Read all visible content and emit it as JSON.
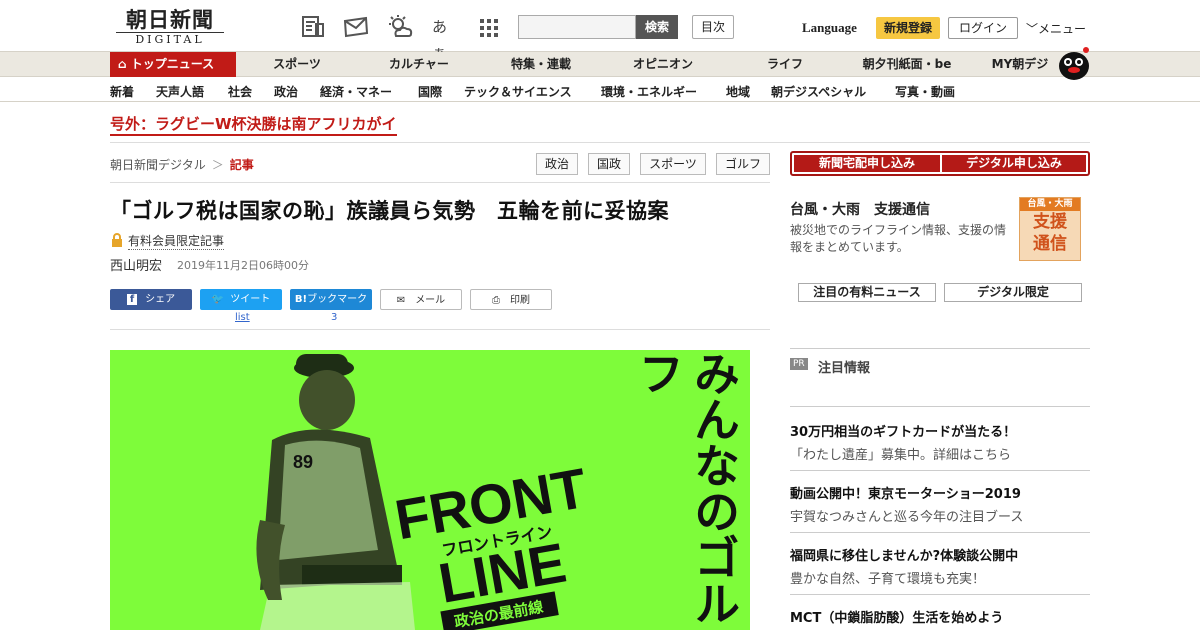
{
  "header": {
    "logo_jp": "朝日新聞",
    "logo_en": "DIGITAL",
    "search_button": "検索",
    "toc_button": "目次",
    "language": "Language",
    "signup": "新規登録",
    "login": "ログイン",
    "menu": "メニュー",
    "icons": [
      "newspaper-icon",
      "mail-icon",
      "weather-icon",
      "font-size-icon",
      "grid-icon"
    ],
    "font_size_label": "あぁ"
  },
  "global_nav": [
    {
      "label": "トップニュース",
      "active": true
    },
    {
      "label": "スポーツ"
    },
    {
      "label": "カルチャー"
    },
    {
      "label": "特集・連載"
    },
    {
      "label": "オピニオン"
    },
    {
      "label": "ライフ"
    },
    {
      "label": "朝夕刊紙面・be"
    },
    {
      "label": "MY朝デジ"
    }
  ],
  "sub_nav": [
    "新着",
    "天声人語",
    "社会",
    "政治",
    "経済・マネー",
    "国際",
    "テック＆サイエンス",
    "環境・エネルギー",
    "地域",
    "朝デジスペシャル",
    "写真・動画"
  ],
  "breaking": "号外：ラグビーW杯決勝は南アフリカがイ",
  "breadcrumb": {
    "site": "朝日新聞デジタル",
    "sep": "＞",
    "current": "記事"
  },
  "tags": [
    "政治",
    "国政",
    "スポーツ",
    "ゴルフ"
  ],
  "article": {
    "headline": "「ゴルフ税は国家の恥」族議員ら気勢　五輪を前に妥協案",
    "paid_label": "有料会員限定記事",
    "author": "西山明宏",
    "date": "2019年11月2日06時00分"
  },
  "share": {
    "facebook": "シェア",
    "twitter": "ツイート",
    "hatena": "ブックマーク",
    "mail": "メール",
    "print": "印刷",
    "twitter_count": "list",
    "hatena_count": "3"
  },
  "hero": {
    "vertical_text": "みんなのゴルフ",
    "front": "FRONT",
    "line": "LINE",
    "kana": "フロントライン",
    "subtitle": "政治の最前線",
    "cap_text": "89",
    "colors": {
      "bg": "#7efc3a",
      "ink": "#111111"
    }
  },
  "sidebar": {
    "tabs": [
      "新聞宅配申し込み",
      "デジタル申し込み"
    ],
    "typhoon_title": "台風・大雨　支援通信",
    "typhoon_desc": "被災地でのライフライン情報、支援の情報をまとめています。",
    "typhoon_badge": [
      "台風・大雨",
      "支援",
      "通信"
    ],
    "boxes": [
      "注目の有料ニュース",
      "デジタル限定"
    ],
    "pr_badge": "PR",
    "pr_title": "注目情報",
    "ads": [
      {
        "title": "30万円相当のギフトカードが当たる！",
        "sub": "「わたし遺産」募集中。詳細はこちら"
      },
      {
        "title": "動画公開中！東京モーターショー2019",
        "sub": "宇賀なつみさんと巡る今年の注目ブース"
      },
      {
        "title": "福岡県に移住しませんか?体験談公開中",
        "sub": "豊かな自然、子育て環境も充実！"
      },
      {
        "title": "MCT（中鎖脂肪酸）生活を始めよう",
        "sub": ""
      }
    ]
  },
  "colors": {
    "brand_red": "#c11b17",
    "nav_bg": "#ebe8e0",
    "accent_yellow": "#f6c741"
  }
}
